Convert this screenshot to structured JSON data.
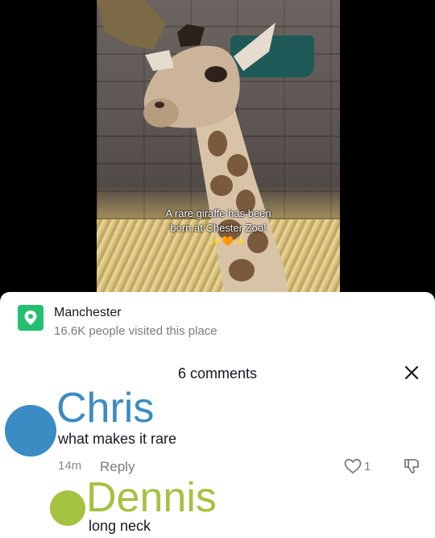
{
  "video": {
    "caption_line1": "A rare giraffe has been",
    "caption_line2": "born at Chester Zoo!",
    "caption_emoji": "✨🧡✨"
  },
  "place": {
    "icon": "location-pin-icon",
    "name": "Manchester",
    "visitors": "16.6K people visited this place",
    "accent": "#24c06f"
  },
  "comments_panel": {
    "title": "6 comments",
    "close_icon": "close-icon",
    "comments": [
      {
        "author": "Chris",
        "author_color": "#3b8cc2",
        "text": "what makes it rare",
        "age": "14m",
        "reply_label": "Reply",
        "likes": "1"
      },
      {
        "author": "Dennis",
        "author_color": "#a5c240",
        "text": "long neck"
      }
    ]
  }
}
